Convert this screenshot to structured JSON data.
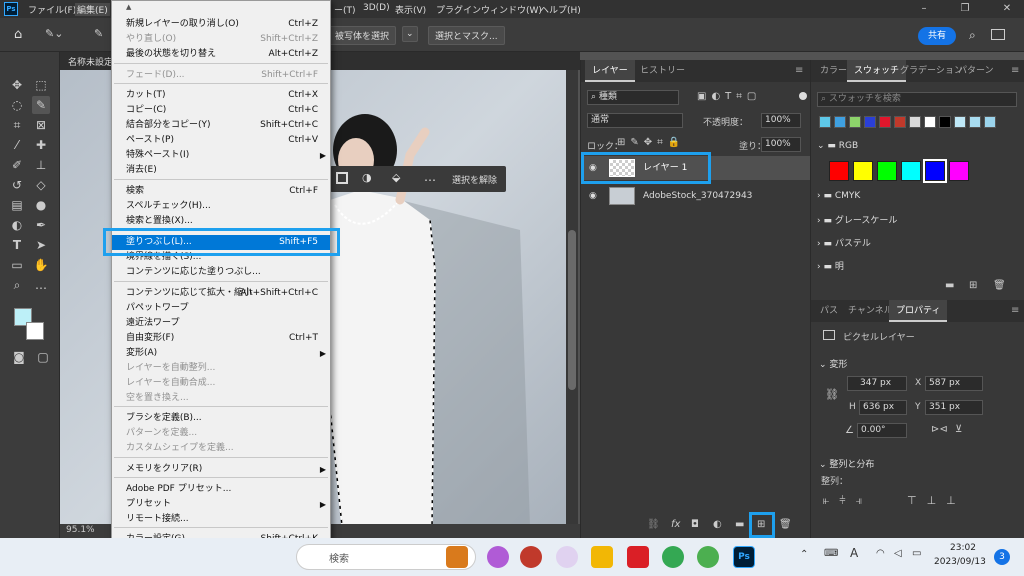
{
  "app": {
    "logo": "Ps"
  },
  "menubar": {
    "items": [
      "ファイル(F)",
      "編集(E)",
      "ー(T)",
      "3D(D)",
      "表示(V)",
      "プラグイン",
      "ウィンドウ(W)",
      "ヘルプ(H)"
    ]
  },
  "window_controls": {
    "minimize": "–",
    "restore": "❐",
    "close": "✕"
  },
  "options": {
    "select_subject": "被写体を選択",
    "select_mask": "選択とマスク...",
    "share": "共有"
  },
  "document": {
    "tab_title": "名称未設定",
    "zoom": "95.1%"
  },
  "edit_menu": {
    "items": [
      {
        "label": "新規レイヤーの取り消し(O)",
        "shortcut": "Ctrl+Z",
        "disabled": false
      },
      {
        "label": "やり直し(O)",
        "shortcut": "Shift+Ctrl+Z",
        "disabled": true
      },
      {
        "label": "最後の状態を切り替え",
        "shortcut": "Alt+Ctrl+Z",
        "disabled": false
      },
      {
        "label": "フェード(D)...",
        "shortcut": "Shift+Ctrl+F",
        "disabled": true
      },
      {
        "label": "カット(T)",
        "shortcut": "Ctrl+X",
        "disabled": false
      },
      {
        "label": "コピー(C)",
        "shortcut": "Ctrl+C",
        "disabled": false
      },
      {
        "label": "結合部分をコピー(Y)",
        "shortcut": "Shift+Ctrl+C",
        "disabled": false
      },
      {
        "label": "ペースト(P)",
        "shortcut": "Ctrl+V",
        "disabled": false
      },
      {
        "label": "特殊ペースト(I)",
        "shortcut": "",
        "disabled": false,
        "submenu": true
      },
      {
        "label": "消去(E)",
        "shortcut": "",
        "disabled": false
      },
      {
        "label": "検索",
        "shortcut": "Ctrl+F",
        "disabled": false
      },
      {
        "label": "スペルチェック(H)...",
        "shortcut": "",
        "disabled": false
      },
      {
        "label": "検索と置換(X)...",
        "shortcut": "",
        "disabled": false
      },
      {
        "label": "塗りつぶし(L)...",
        "shortcut": "Shift+F5",
        "disabled": false,
        "highlighted": true
      },
      {
        "label": "境界線を描く(S)...",
        "shortcut": "",
        "disabled": false
      },
      {
        "label": "コンテンツに応じた塗りつぶし...",
        "shortcut": "",
        "disabled": false
      },
      {
        "label": "コンテンツに応じて拡大・縮小",
        "shortcut": "Alt+Shift+Ctrl+C",
        "disabled": false
      },
      {
        "label": "パペットワープ",
        "shortcut": "",
        "disabled": false
      },
      {
        "label": "遠近法ワープ",
        "shortcut": "",
        "disabled": false
      },
      {
        "label": "自由変形(F)",
        "shortcut": "Ctrl+T",
        "disabled": false
      },
      {
        "label": "変形(A)",
        "shortcut": "",
        "disabled": false,
        "submenu": true
      },
      {
        "label": "レイヤーを自動整列...",
        "shortcut": "",
        "disabled": true
      },
      {
        "label": "レイヤーを自動合成...",
        "shortcut": "",
        "disabled": true
      },
      {
        "label": "空を置き換え...",
        "shortcut": "",
        "disabled": true
      },
      {
        "label": "ブラシを定義(B)...",
        "shortcut": "",
        "disabled": false
      },
      {
        "label": "パターンを定義...",
        "shortcut": "",
        "disabled": true
      },
      {
        "label": "カスタムシェイプを定義...",
        "shortcut": "",
        "disabled": true
      },
      {
        "label": "メモリをクリア(R)",
        "shortcut": "",
        "disabled": false,
        "submenu": true
      },
      {
        "label": "Adobe PDF プリセット...",
        "shortcut": "",
        "disabled": false
      },
      {
        "label": "プリセット",
        "shortcut": "",
        "disabled": false,
        "submenu": true
      },
      {
        "label": "リモート接続...",
        "shortcut": "",
        "disabled": false
      },
      {
        "label": "カラー設定(G)...",
        "shortcut": "Shift+Ctrl+K",
        "disabled": false
      }
    ]
  },
  "selection_bar": {
    "deselect": "選択を解除"
  },
  "layers_panel": {
    "tabs": [
      "レイヤー",
      "ヒストリー"
    ],
    "filter": "種類",
    "blend_mode": "通常",
    "opacity_label": "不透明度：",
    "opacity_value": "100%",
    "lock_label": "ロック：",
    "fill_label": "塗り：",
    "fill_value": "100%",
    "layers": [
      {
        "name": "レイヤー 1",
        "selected": true
      },
      {
        "name": "AdobeStock_370472943",
        "selected": false
      }
    ]
  },
  "swatches_panel": {
    "tabs": [
      "カラー",
      "スウォッチ",
      "グラデーション",
      "パターン"
    ],
    "search_placeholder": "スウォッチを検索",
    "recent_colors": [
      "#5ec8e8",
      "#3fa0e0",
      "#8dd36b",
      "#2a3fd6",
      "#e0162c",
      "#c0392b",
      "#d9d9d9",
      "#ffffff",
      "#000000",
      "#bfe8f7",
      "#a8dcf0",
      "#9bd4ec"
    ],
    "groups": [
      "RGB",
      "CMYK",
      "グレースケール",
      "パステル",
      "明"
    ],
    "rgb_colors": [
      "#ff0000",
      "#ffff00",
      "#00ff00",
      "#00ffff",
      "#0000ff",
      "#ff00ff"
    ]
  },
  "properties_panel": {
    "tabs": [
      "パス",
      "チャンネル",
      "プロパティ"
    ],
    "type": "ピクセルレイヤー",
    "transform_title": "変形",
    "W": "347 px",
    "X": "587 px",
    "H": "636 px",
    "Y": "351 px",
    "angle": "0.00°",
    "align_title": "整列と分布",
    "align_label": "整列："
  },
  "taskbar": {
    "search": "検索",
    "time": "23:02",
    "date": "2023/09/13",
    "badge": "3",
    "ime": "A"
  },
  "colors": {
    "fg": "#bdf0f8",
    "bg": "#ffffff",
    "highlight": "#1ea0ee",
    "accent": "#1473e6"
  }
}
